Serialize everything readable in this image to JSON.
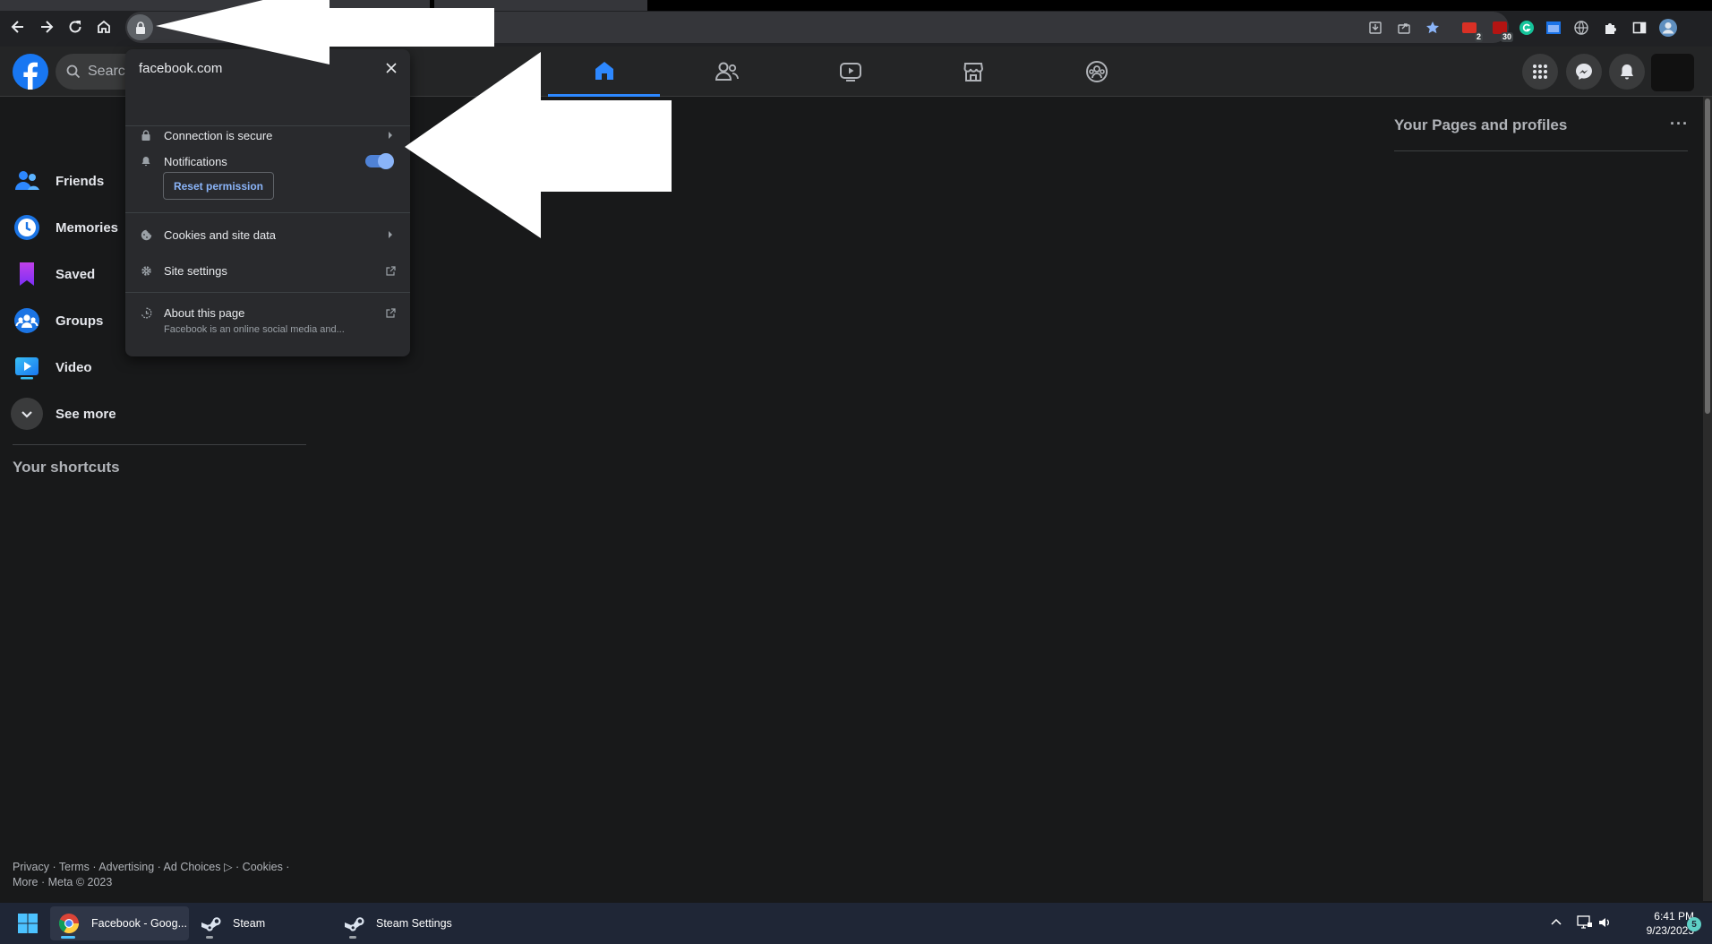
{
  "browser": {
    "nav": [
      "back-icon",
      "forward-icon",
      "reload-icon",
      "home-icon"
    ],
    "extension_badges": {
      "ext1": "2",
      "ext2": "30"
    },
    "accent": "#8ab4f8"
  },
  "facebook": {
    "search_placeholder": "Search",
    "brand_color": "#1877f2",
    "sidebar": {
      "items": [
        {
          "label": "Friends",
          "icon": "friends-icon"
        },
        {
          "label": "Memories",
          "icon": "memories-icon"
        },
        {
          "label": "Saved",
          "icon": "saved-icon"
        },
        {
          "label": "Groups",
          "icon": "groups-icon"
        },
        {
          "label": "Video",
          "icon": "video-icon"
        },
        {
          "label": "See more",
          "icon": "chevron-down-icon"
        }
      ],
      "shortcuts_title": "Your shortcuts"
    },
    "right": {
      "pages_title": "Your Pages and profiles",
      "more": "···"
    },
    "footer": {
      "line1": "Privacy · Terms · Advertising · Ad Choices ▷ · Cookies ·",
      "line2": "More · Meta © 2023"
    }
  },
  "popup": {
    "title": "facebook.com",
    "connection": "Connection is secure",
    "notifications": "Notifications",
    "notifications_enabled": true,
    "reset": "Reset permission",
    "cookies": "Cookies and site data",
    "site_settings": "Site settings",
    "about": "About this page",
    "about_sub": "Facebook is an online social media and..."
  },
  "taskbar": {
    "apps": [
      {
        "label": "Facebook - Goog...",
        "icon": "chrome-icon"
      },
      {
        "label": "Steam",
        "icon": "steam-icon"
      },
      {
        "label": "Steam Settings",
        "icon": "steam-icon"
      }
    ],
    "time": "6:41 PM",
    "date": "9/23/2023",
    "notification_count": "5"
  }
}
